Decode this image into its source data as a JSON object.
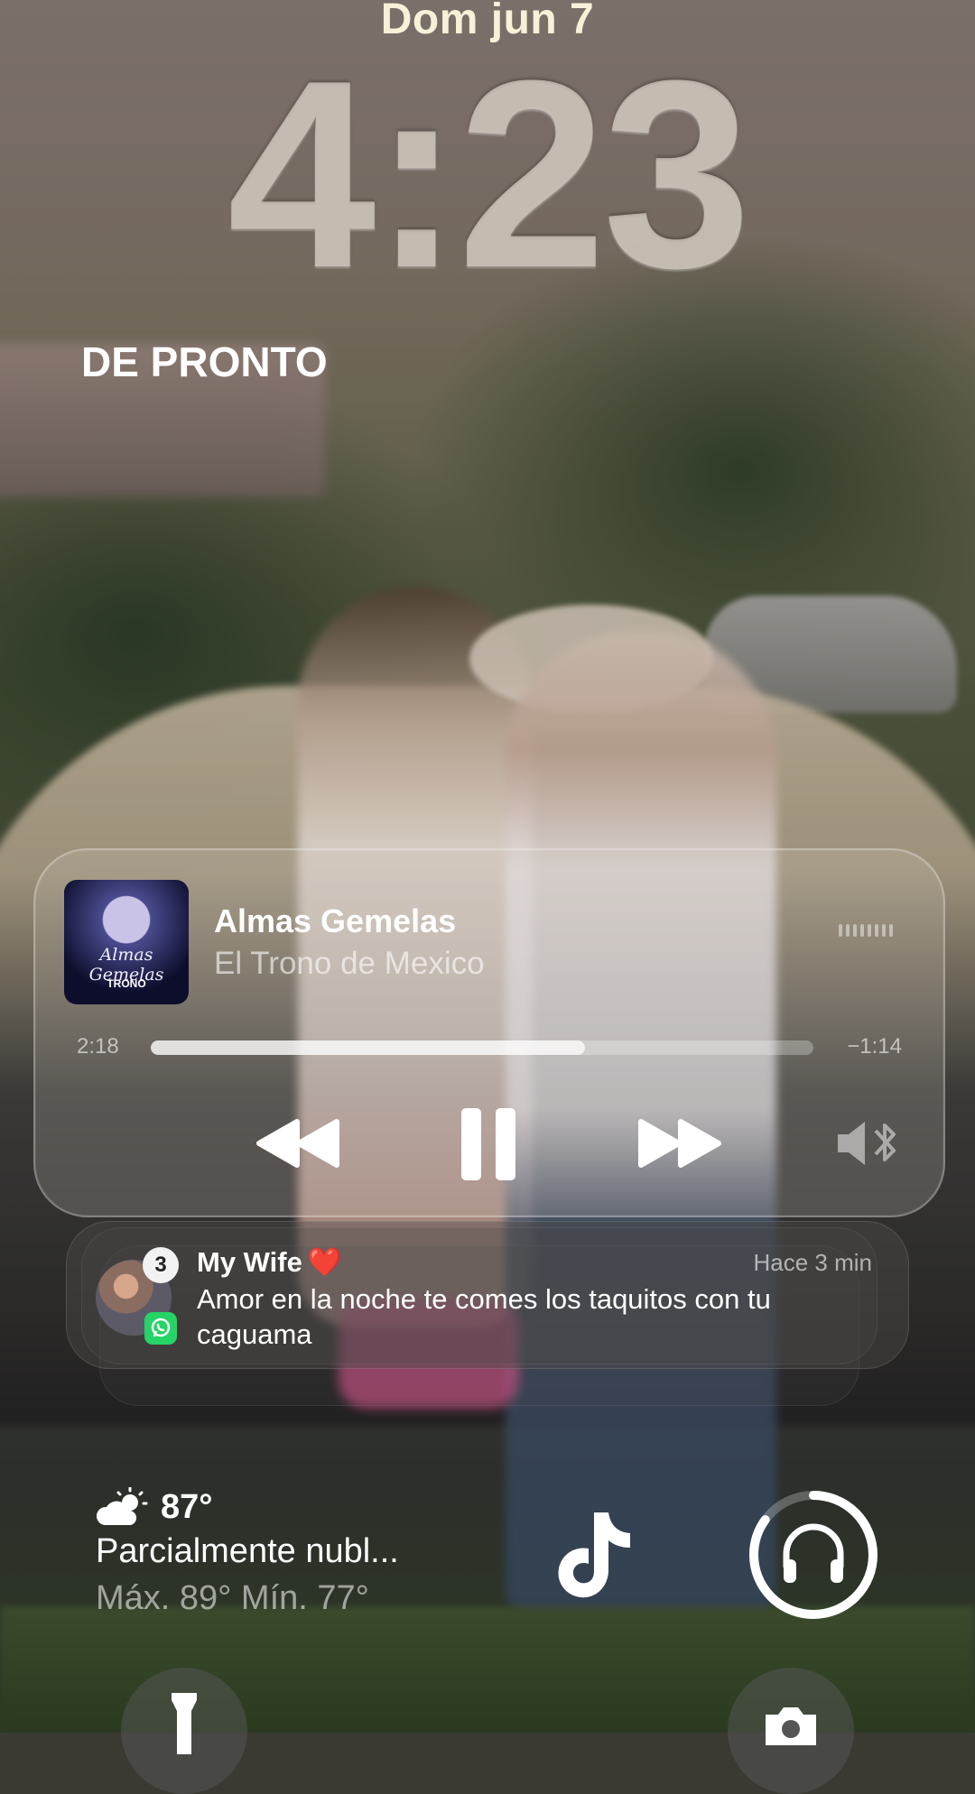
{
  "lock": {
    "date": "Dom jun 7",
    "time": "4:23",
    "top_widget": "DE PRONTO"
  },
  "now_playing": {
    "title": "Almas Gemelas",
    "artist": "El Trono de Mexico",
    "elapsed": "2:18",
    "remaining": "−1:14",
    "progress": 0.655,
    "artwork": {
      "title": "Almas Gemelas",
      "label": "TRONO"
    },
    "controls": [
      "rewind-icon",
      "pause-icon",
      "fast-forward-icon",
      "speaker-bluetooth-icon"
    ]
  },
  "notification": {
    "sender": "My Wife",
    "heart": "❤️",
    "time": "Hace 3 min",
    "body": "Amor en la noche te comes los taquitos con tu caguama",
    "badge_count": "3",
    "app_icon": "whatsapp-icon",
    "app_color": "#25d366"
  },
  "weather": {
    "temp": "87°",
    "condition": "Parcialmente nubl...",
    "range": "Máx. 89° Mín. 77°",
    "icon": "partly-cloudy-icon"
  },
  "widgets": {
    "app_icon": "tiktok-icon",
    "ring_icon": "headphones-icon",
    "ring_progress": 0.85
  },
  "quick_actions": [
    "flashlight-icon",
    "camera-icon"
  ]
}
